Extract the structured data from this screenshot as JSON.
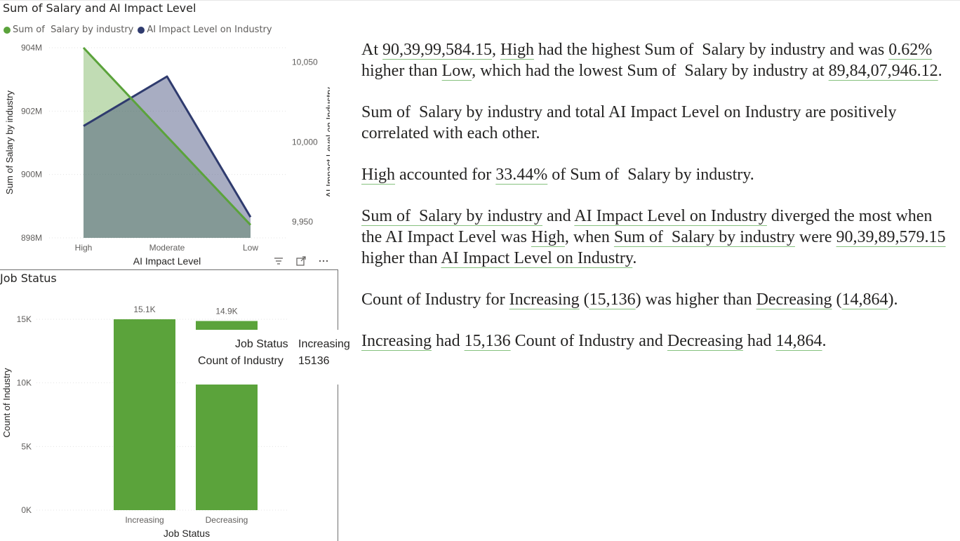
{
  "chart_data": [
    {
      "type": "area",
      "title": "Sum of Salary and AI Impact Level",
      "xlabel": "AI Impact Level",
      "ylabel": "Sum of Salary by industry",
      "y2label": "AI Impact Level on Industry",
      "categories": [
        "High",
        "Moderate",
        "Low"
      ],
      "series": [
        {
          "name": "Sum of  Salary by industry",
          "axis": "left",
          "color": "#5ba33b",
          "values": [
            903999584.15,
            901200000,
            898407946.12
          ]
        },
        {
          "name": "AI Impact Level on Industry",
          "axis": "right",
          "color": "#2f3b6e",
          "values": [
            10010,
            10041,
            9953
          ]
        }
      ],
      "ylim": [
        898000000,
        904000000
      ],
      "y2lim": [
        9940,
        10059
      ],
      "yticks": [
        "898M",
        "900M",
        "902M",
        "904M"
      ],
      "y2ticks": [
        "9,950",
        "10,000",
        "10,050"
      ],
      "legend": "top-left",
      "grid": true
    },
    {
      "type": "bar",
      "title": "Job Status",
      "xlabel": "Job Status",
      "ylabel": "Count of Industry",
      "categories": [
        "Increasing",
        "Decreasing"
      ],
      "values": [
        15136,
        14864
      ],
      "data_labels": [
        "15.1K",
        "14.9K"
      ],
      "yticks": [
        "0K",
        "5K",
        "10K",
        "15K"
      ],
      "ylim": [
        0,
        15000
      ],
      "color": "#5ba33b",
      "grid": true
    }
  ],
  "tooltip": {
    "rows": [
      {
        "label": "Job Status",
        "value": "Increasing"
      },
      {
        "label": "Count of Industry",
        "value": "15136"
      }
    ]
  },
  "icons": [
    "filter-icon",
    "focus-mode-icon",
    "more-options-icon"
  ],
  "narrative": {
    "p1": {
      "t1": "At ",
      "v1": "90,39,99,584.15",
      "t2": ", ",
      "v2": "High",
      "t3": " had the highest Sum of  Salary by industry and was ",
      "v3": "0.62%",
      "t4": " higher than ",
      "v4": "Low",
      "t5": ", which had the lowest Sum of  Salary by industry at ",
      "v5": "89,84,07,946.12",
      "t6": "."
    },
    "p2": {
      "t1": "Sum of  Salary by industry and total AI Impact Level on Industry are positively correlated with each other."
    },
    "p3": {
      "v1": "High",
      "t1": " accounted for ",
      "v2": "33.44%",
      "t2": " of Sum of  Salary by industry."
    },
    "p4": {
      "v1": "Sum of  Salary by industry",
      "t1": " and ",
      "v2": "AI Impact Level on Industry",
      "t2": " diverged the most when the AI Impact Level was ",
      "v3": "High",
      "t3": ", when ",
      "v4": "Sum of  Salary by industry",
      "t4": " were ",
      "v5": "90,39,89,579.15",
      "t5": " higher than ",
      "v6": "AI Impact Level on Industry",
      "t6": "."
    },
    "p5": {
      "t1": "Count of Industry for ",
      "v1": "Increasing",
      "t2": " (",
      "v2": "15,136",
      "t3": ") was higher than ",
      "v3": "Decreasing",
      "t4": " (",
      "v4": "14,864",
      "t5": ")."
    },
    "p6": {
      "v1": "Increasing",
      "t1": " had ",
      "v2": "15,136",
      "t2": " Count of Industry and ",
      "v3": "Decreasing",
      "t3": " had ",
      "v4": "14,864",
      "t4": "."
    }
  }
}
